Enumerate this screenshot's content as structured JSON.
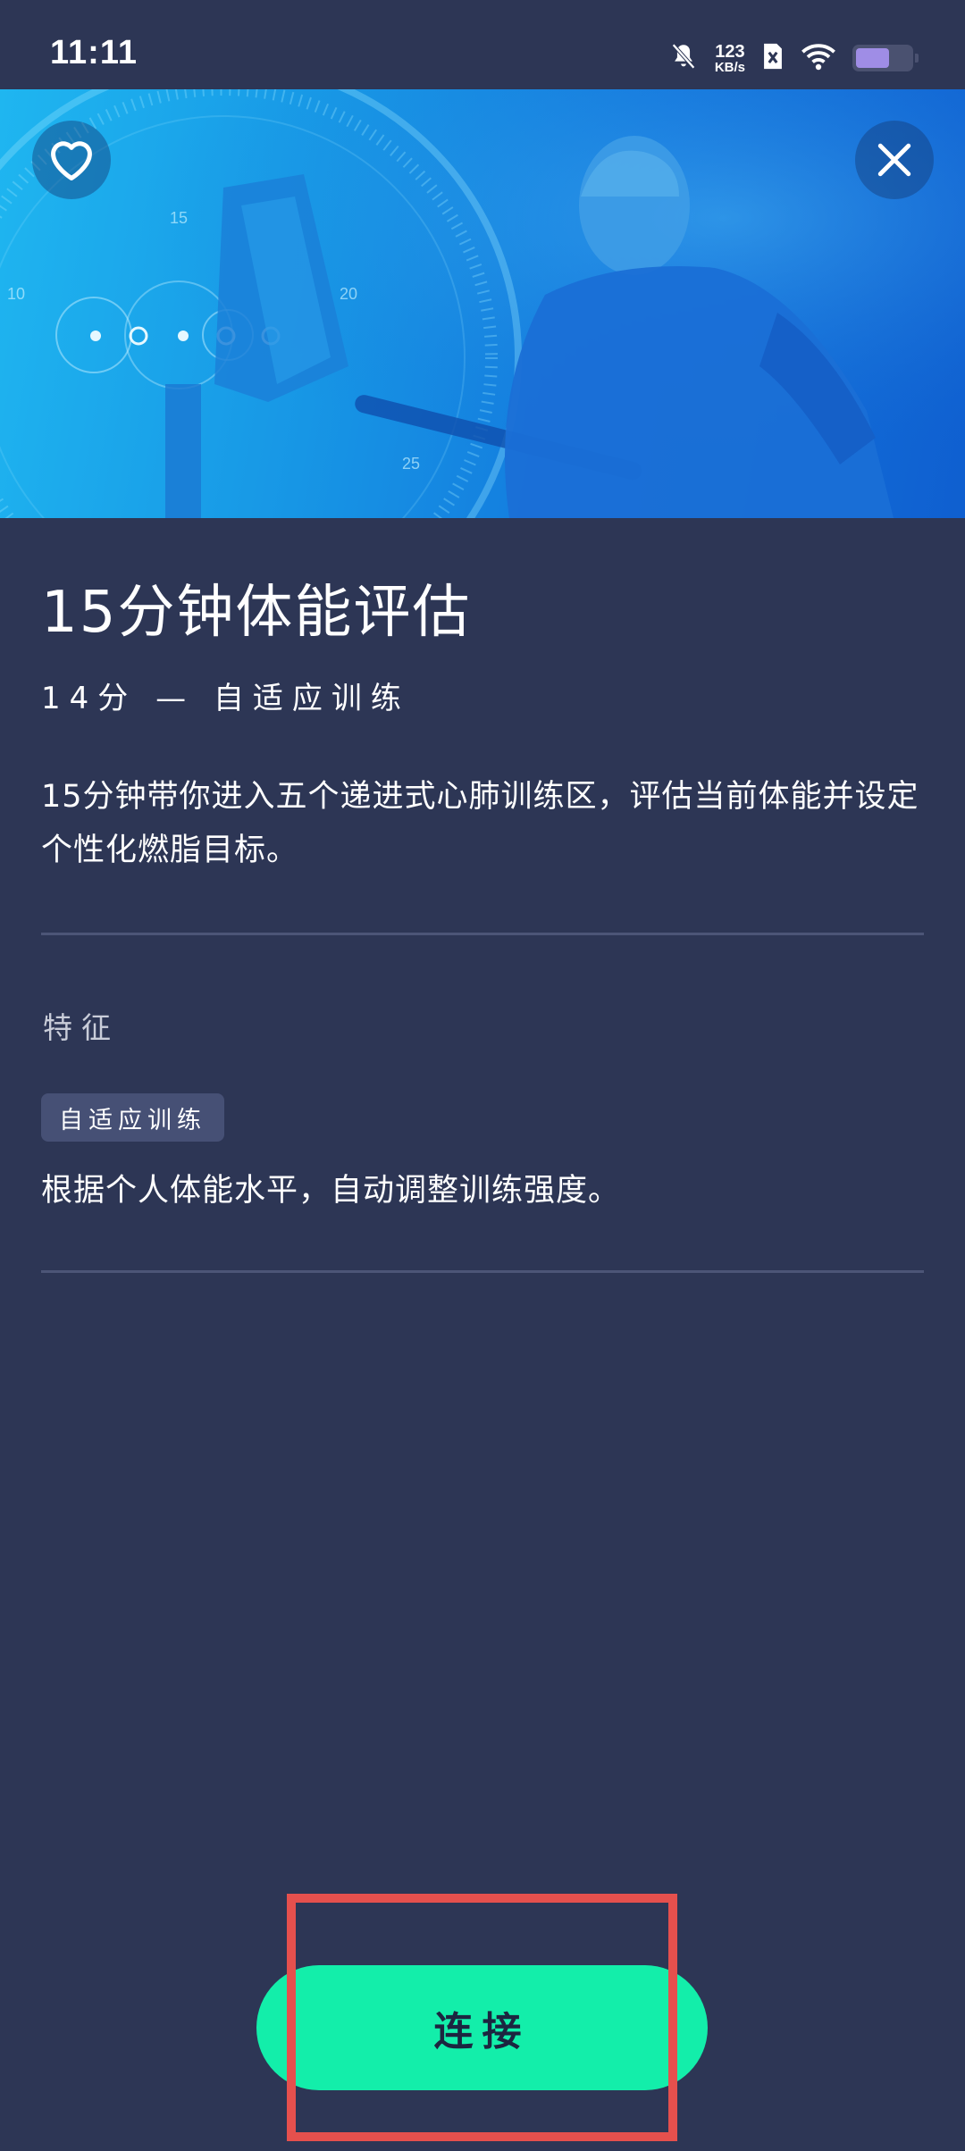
{
  "status_bar": {
    "time": "11:11",
    "net_speed_value": "123",
    "net_speed_unit": "KB/s",
    "icons": [
      "mute-bell-icon",
      "sim-off-icon",
      "wifi-icon",
      "battery-icon"
    ],
    "battery_level": 0.62
  },
  "hero": {
    "dial_labels": [
      "10",
      "15",
      "20",
      "25"
    ]
  },
  "workout": {
    "title": "15分钟体能评估",
    "meta": "14分 — 自适应训练",
    "description": "15分钟带你进入五个递进式心肺训练区，评估当前体能并设定个性化燃脂目标。"
  },
  "features": {
    "section_label": "特征",
    "tag": "自适应训练",
    "tag_description": "根据个人体能水平，自动调整训练强度。"
  },
  "actions": {
    "connect_label": "连接"
  },
  "colors": {
    "background": "#2d3655",
    "accent": "#13eeaa",
    "highlight": "#e5504d"
  }
}
